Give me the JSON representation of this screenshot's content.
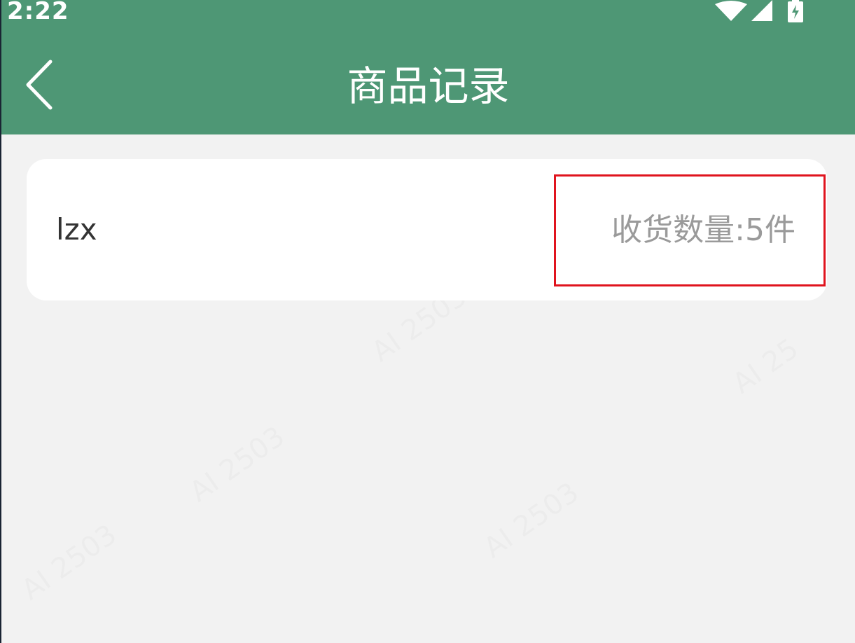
{
  "status_bar": {
    "time": "2:22",
    "icons": [
      "wifi-icon",
      "cell-signal-icon",
      "battery-charging-icon"
    ]
  },
  "header": {
    "title": "商品记录",
    "back_icon": "chevron-left-icon"
  },
  "records": [
    {
      "name": "lzx",
      "quantity_text": "收货数量:5件"
    }
  ],
  "colors": {
    "header_bg": "#4e9775",
    "page_bg": "#f2f2f2",
    "card_bg": "#ffffff",
    "highlight": "#e0141e"
  }
}
